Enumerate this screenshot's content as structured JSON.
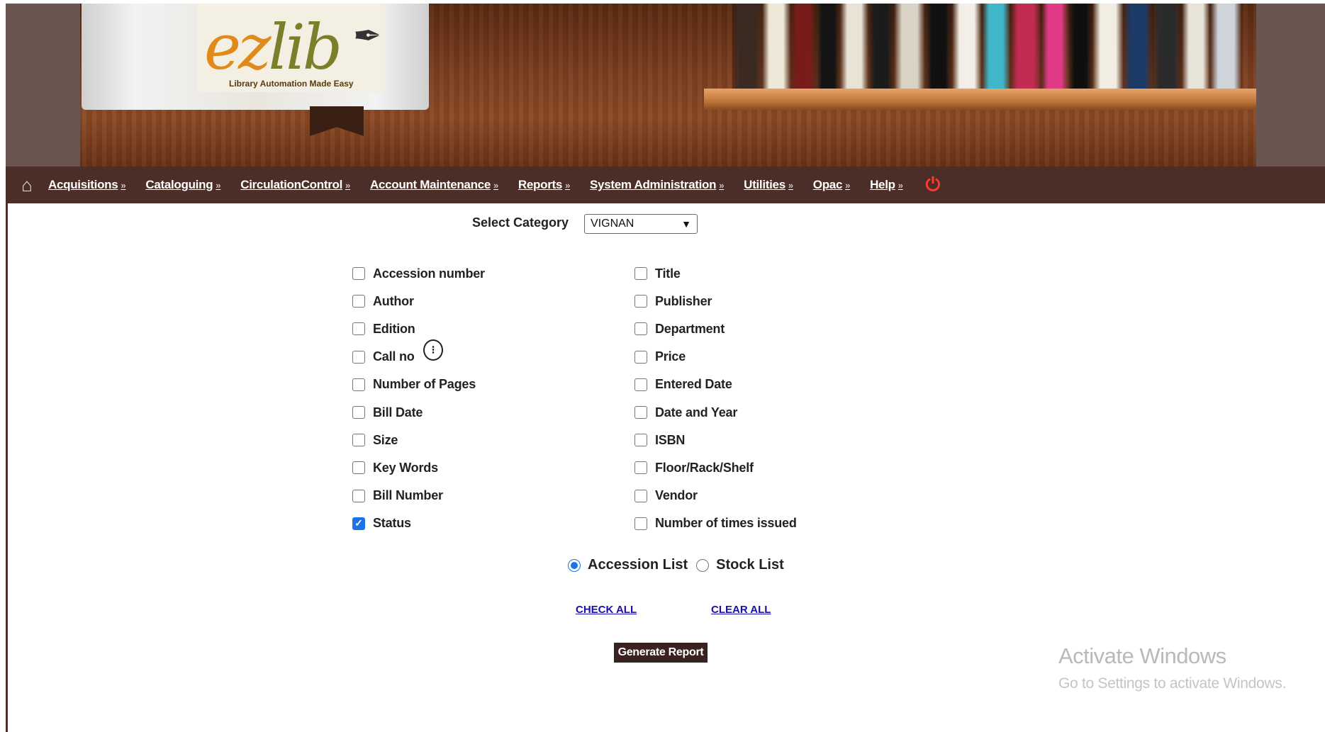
{
  "banner": {
    "logo_ez": "ez",
    "logo_lib": "lib",
    "logo_tagline": "Library Automation Made Easy",
    "book_colors": [
      "#3a2a22",
      "#efe8d8",
      "#7a1b1b",
      "#141414",
      "#e9e3d6",
      "#1b1b1b",
      "#d9d2c5",
      "#111111",
      "#f4efe6",
      "#3fb6c9",
      "#c42b52",
      "#e13a87",
      "#0f0f0f",
      "#f2ede2",
      "#1b3a66",
      "#2b2b2b",
      "#e9e4da",
      "#cfd4da"
    ]
  },
  "nav": {
    "home_icon": "home-icon",
    "items": [
      {
        "label": "Acquisitions"
      },
      {
        "label": "Cataloguing"
      },
      {
        "label": "CirculationControl"
      },
      {
        "label": "Account Maintenance"
      },
      {
        "label": "Reports"
      },
      {
        "label": "System Administration"
      },
      {
        "label": "Utilities"
      },
      {
        "label": "Opac"
      },
      {
        "label": "Help"
      }
    ],
    "chevron": "»",
    "power_icon": "power-icon"
  },
  "form": {
    "select_label": "Select Category",
    "select_value": "VIGNAN",
    "left_checkboxes": [
      {
        "label": "Accession number",
        "checked": false
      },
      {
        "label": "Author",
        "checked": false
      },
      {
        "label": "Edition",
        "checked": false
      },
      {
        "label": "Call no",
        "checked": false
      },
      {
        "label": "Number of Pages",
        "checked": false
      },
      {
        "label": "Bill Date",
        "checked": false
      },
      {
        "label": "Size",
        "checked": false
      },
      {
        "label": "Key Words",
        "checked": false
      },
      {
        "label": "Bill Number",
        "checked": false
      },
      {
        "label": "Status",
        "checked": true
      }
    ],
    "right_checkboxes": [
      {
        "label": "Title",
        "checked": false
      },
      {
        "label": "Publisher",
        "checked": false
      },
      {
        "label": "Department",
        "checked": false
      },
      {
        "label": "Price",
        "checked": false
      },
      {
        "label": "Entered Date",
        "checked": false
      },
      {
        "label": "Date and Year",
        "checked": false
      },
      {
        "label": "ISBN",
        "checked": false
      },
      {
        "label": "Floor/Rack/Shelf",
        "checked": false
      },
      {
        "label": "Vendor",
        "checked": false
      },
      {
        "label": "Number of times issued",
        "checked": false
      }
    ],
    "radios": [
      {
        "label": "Accession List",
        "checked": true
      },
      {
        "label": "Stock List",
        "checked": false
      }
    ],
    "check_all": "CHECK ALL",
    "clear_all": "CLEAR ALL",
    "generate_button": "Generate Report"
  },
  "watermark": {
    "title": "Activate Windows",
    "subtitle": "Go to Settings to activate Windows."
  }
}
